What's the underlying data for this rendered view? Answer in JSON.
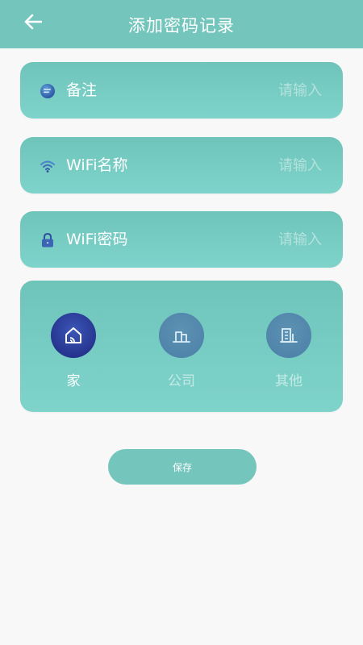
{
  "header": {
    "title": "添加密码记录",
    "back_icon": "arrow-left-icon"
  },
  "fields": [
    {
      "label": "备注",
      "placeholder": "请输入",
      "value": "",
      "icon": "note-icon"
    },
    {
      "label": "WiFi名称",
      "placeholder": "请输入",
      "value": "",
      "icon": "wifi-icon"
    },
    {
      "label": "WiFi密码",
      "placeholder": "请输入",
      "value": "",
      "icon": "lock-icon"
    }
  ],
  "categories": [
    {
      "label": "家",
      "icon": "home-icon",
      "selected": true
    },
    {
      "label": "公司",
      "icon": "company-building-icon",
      "selected": false
    },
    {
      "label": "其他",
      "icon": "other-building-icon",
      "selected": false
    }
  ],
  "save_label": "保存",
  "colors": {
    "primary": "#74c6bd",
    "background": "#f8f8f8",
    "selected_category": "#26358f",
    "unselected_category": "#4b7fa7",
    "placeholder": "#b4e2dd"
  }
}
